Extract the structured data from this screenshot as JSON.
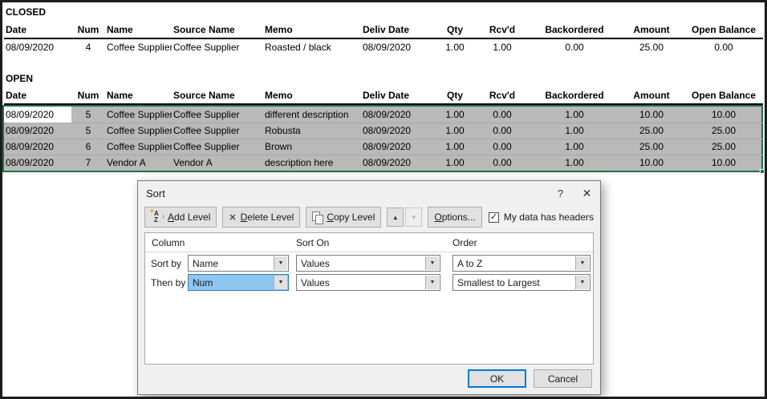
{
  "colors": {
    "selection_gray": "#b9b9b9",
    "selection_green": "#1e7145",
    "focus_blue": "#0078d7",
    "combo_selected_blue": "#8ec6f0"
  },
  "columns": [
    "Date",
    "Num",
    "Name",
    "Source Name",
    "Memo",
    "Deliv Date",
    "Qty",
    "Rcv'd",
    "Backordered",
    "Amount",
    "Open Balance"
  ],
  "closed": {
    "label": "CLOSED",
    "rows": [
      [
        "08/09/2020",
        "4",
        "Coffee Supplier",
        "Coffee Supplier",
        "Roasted / black",
        "08/09/2020",
        "1.00",
        "1.00",
        "0.00",
        "25.00",
        "0.00"
      ]
    ]
  },
  "open": {
    "label": "OPEN",
    "rows": [
      [
        "08/09/2020",
        "5",
        "Coffee Supplier",
        "Coffee Supplier",
        "different description",
        "08/09/2020",
        "1.00",
        "0.00",
        "1.00",
        "10.00",
        "10.00"
      ],
      [
        "08/09/2020",
        "5",
        "Coffee Supplier",
        "Coffee Supplier",
        "Robusta",
        "08/09/2020",
        "1.00",
        "0.00",
        "1.00",
        "25.00",
        "25.00"
      ],
      [
        "08/09/2020",
        "6",
        "Coffee Supplier",
        "Coffee Supplier",
        "Brown",
        "08/09/2020",
        "1.00",
        "0.00",
        "1.00",
        "25.00",
        "25.00"
      ],
      [
        "08/09/2020",
        "7",
        "Vendor A",
        "Vendor A",
        "description here",
        "08/09/2020",
        "1.00",
        "0.00",
        "1.00",
        "10.00",
        "10.00"
      ]
    ]
  },
  "dialog": {
    "title": "Sort",
    "help_icon": "?",
    "close_icon": "✕",
    "toolbar": {
      "add_level": {
        "key": "A",
        "rest": "dd Level"
      },
      "delete_level": {
        "key": "D",
        "rest": "elete Level"
      },
      "copy_level": {
        "key": "C",
        "rest": "opy Level"
      },
      "move_up_icon": "▲",
      "move_down_icon": "▼",
      "options": {
        "key": "O",
        "rest": "ptions..."
      },
      "headers_checkbox": {
        "checked": true,
        "label": "My data has headers"
      }
    },
    "grid": {
      "headers": {
        "column": "Column",
        "sort_on": "Sort On",
        "order": "Order"
      },
      "levels": [
        {
          "label": "Sort by",
          "column": "Name",
          "sort_on": "Values",
          "order": "A to Z"
        },
        {
          "label": "Then by",
          "column": "Num",
          "sort_on": "Values",
          "order": "Smallest to Largest"
        }
      ]
    },
    "buttons": {
      "ok": "OK",
      "cancel": "Cancel"
    },
    "icons": {
      "az_top": "A",
      "az_bottom": "Z",
      "az_star": "✦",
      "az_arrow": "↓",
      "delete": "✕",
      "dropdown": "▼",
      "check": "✓"
    }
  }
}
